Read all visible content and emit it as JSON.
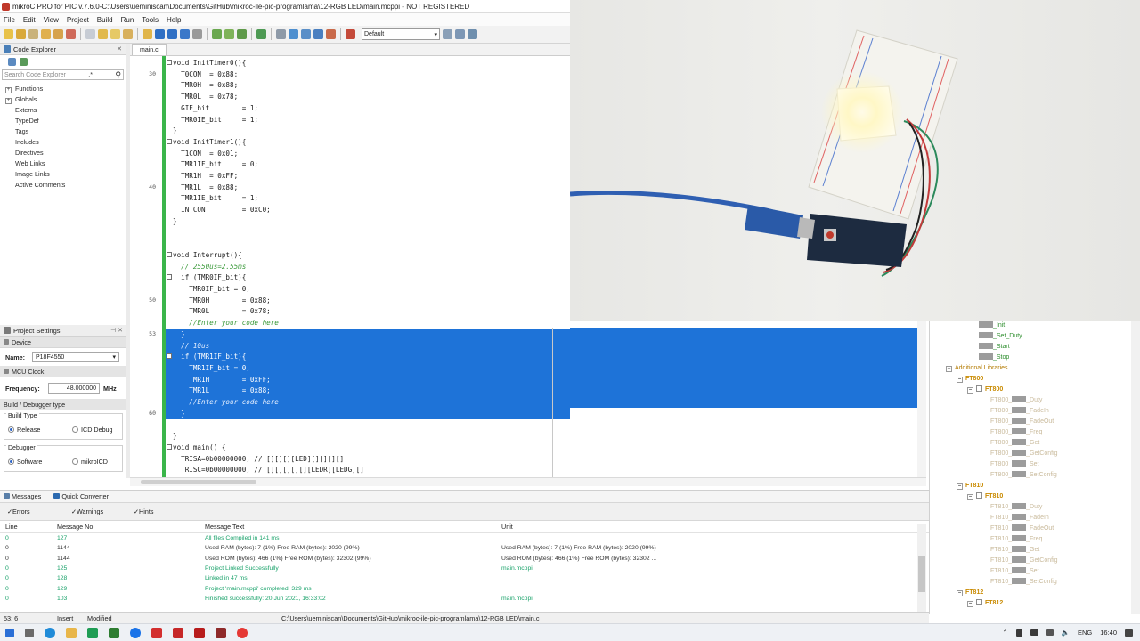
{
  "window": {
    "title": "mikroC PRO for PIC v.7.6.0-C:\\Users\\ueminiscan\\Documents\\GitHub\\mikroc-ile-pic-programlama\\12-RGB LED\\main.mcppi - NOT REGISTERED"
  },
  "menu": [
    "File",
    "Edit",
    "View",
    "Project",
    "Build",
    "Run",
    "Tools",
    "Help"
  ],
  "toolbar": {
    "config_combo": "Default"
  },
  "code_explorer": {
    "title": "Code Explorer",
    "close": "✕",
    "search_placeholder": "Search Code Explorer",
    "search_glyph": ".*",
    "items": [
      {
        "expander": "+",
        "label": "Functions"
      },
      {
        "expander": "+",
        "label": "Globals"
      },
      {
        "expander": "",
        "label": "Externs"
      },
      {
        "expander": "",
        "label": "TypeDef"
      },
      {
        "expander": "",
        "label": "Tags"
      },
      {
        "expander": "",
        "label": "Includes"
      },
      {
        "expander": "",
        "label": "Directives"
      },
      {
        "expander": "",
        "label": "Web Links"
      },
      {
        "expander": "",
        "label": "Image Links"
      },
      {
        "expander": "",
        "label": "Active Comments"
      }
    ]
  },
  "project_settings": {
    "title": "Project Settings",
    "device_group": "Device",
    "name_label": "Name:",
    "name_value": "P18F4550",
    "mcu_clock_group": "MCU Clock",
    "freq_label": "Frequency:",
    "freq_value": "48.000000",
    "freq_unit": "MHz",
    "build_group": "Build / Debugger type",
    "build_type_label": "Build Type",
    "release": "Release",
    "icd_debug": "ICD Debug",
    "debugger_label": "Debugger",
    "software": "Software",
    "mikroicd": "mikroICD"
  },
  "editor": {
    "tab": "main.c",
    "line_numbers": [
      {
        "n": "30",
        "row": 1
      },
      {
        "n": "40",
        "row": 11
      },
      {
        "n": "50",
        "row": 21
      },
      {
        "n": "53",
        "row": 24
      },
      {
        "n": "60",
        "row": 31
      }
    ],
    "lines": [
      {
        "text": "void InitTimer0(){",
        "mark": true
      },
      {
        "text": "  T0CON  = 0x88;"
      },
      {
        "text": "  TMR0H  = 0x88;"
      },
      {
        "text": "  TMR0L  = 0x78;"
      },
      {
        "text": "  GIE_bit        = 1;"
      },
      {
        "text": "  TMR0IE_bit     = 1;"
      },
      {
        "text": "}"
      },
      {
        "text": "void InitTimer1(){",
        "mark": true
      },
      {
        "text": "  T1CON  = 0x01;"
      },
      {
        "text": "  TMR1IF_bit     = 0;"
      },
      {
        "text": "  TMR1H  = 0xFF;"
      },
      {
        "text": "  TMR1L  = 0x88;"
      },
      {
        "text": "  TMR1IE_bit     = 1;"
      },
      {
        "text": "  INTCON         = 0xC0;"
      },
      {
        "text": "}"
      },
      {
        "text": ""
      },
      {
        "text": ""
      },
      {
        "text": "void Interrupt(){",
        "mark": true
      },
      {
        "text": "  // 2550us=2.55ms",
        "cmt": true
      },
      {
        "text": "  if (TMR0IF_bit){",
        "mark": true
      },
      {
        "text": "    TMR0IF_bit = 0;"
      },
      {
        "text": "    TMR0H        = 0x88;"
      },
      {
        "text": "    TMR0L        = 0x78;"
      },
      {
        "text": "    //Enter your code here",
        "cmt": true
      },
      {
        "text": "  }",
        "sel": true
      },
      {
        "text": "  // 10us",
        "sel": true,
        "cmt": true
      },
      {
        "text": "  if (TMR1IF_bit){",
        "sel": true,
        "mark": true
      },
      {
        "text": "    TMR1IF_bit = 0;",
        "sel": true
      },
      {
        "text": "    TMR1H        = 0xFF;",
        "sel": true
      },
      {
        "text": "    TMR1L        = 0x88;",
        "sel": true
      },
      {
        "text": "    //Enter your code here",
        "sel": true,
        "cmt": true
      },
      {
        "text": "  }",
        "sel": true
      },
      {
        "text": ""
      },
      {
        "text": "}"
      },
      {
        "text": "void main() {",
        "mark": true
      },
      {
        "text": "  TRISA=0b00000000; // [][][][LED][][][][]",
        "trail_cmt": true
      },
      {
        "text": "  TRISC=0b00000000; // [][][][][][LEDR][LEDG][]",
        "trail_cmt": true
      }
    ]
  },
  "library_manager": {
    "items": [
      {
        "type": "item-green",
        "label": "_Init",
        "level": 3
      },
      {
        "type": "item-green",
        "label": "_Set_Duty",
        "level": 3
      },
      {
        "type": "item-green",
        "label": "_Start",
        "level": 3
      },
      {
        "type": "item-green",
        "label": "_Stop",
        "level": 3
      },
      {
        "type": "lib",
        "label": "Additional Libraries",
        "level": 0,
        "exp": "–"
      },
      {
        "type": "ft",
        "label": "FT800",
        "level": 1,
        "exp": "–"
      },
      {
        "type": "ftchk",
        "label": "FT800",
        "level": 2,
        "exp": "–"
      },
      {
        "type": "item",
        "label": "FT800_",
        "suffix": "_Duty"
      },
      {
        "type": "item",
        "label": "FT800_",
        "suffix": "_FadeIn"
      },
      {
        "type": "item",
        "label": "FT800_",
        "suffix": "_FadeOut"
      },
      {
        "type": "item",
        "label": "FT800_",
        "suffix": "_Freq"
      },
      {
        "type": "item",
        "label": "FT800_",
        "suffix": "_Get"
      },
      {
        "type": "item",
        "label": "FT800_",
        "suffix": "_GetConfig"
      },
      {
        "type": "item",
        "label": "FT800_",
        "suffix": "_Set"
      },
      {
        "type": "item",
        "label": "FT800_",
        "suffix": "_SetConfig"
      },
      {
        "type": "ft",
        "label": "FT810",
        "level": 1,
        "exp": "–"
      },
      {
        "type": "ftchk",
        "label": "FT810",
        "level": 2,
        "exp": "–"
      },
      {
        "type": "item",
        "label": "FT810_",
        "suffix": "_Duty"
      },
      {
        "type": "item",
        "label": "FT810_",
        "suffix": "_FadeIn"
      },
      {
        "type": "item",
        "label": "FT810_",
        "suffix": "_FadeOut"
      },
      {
        "type": "item",
        "label": "FT810_",
        "suffix": "_Freq"
      },
      {
        "type": "item",
        "label": "FT810_",
        "suffix": "_Get"
      },
      {
        "type": "item",
        "label": "FT810_",
        "suffix": "_GetConfig"
      },
      {
        "type": "item",
        "label": "FT810_",
        "suffix": "_Set"
      },
      {
        "type": "item",
        "label": "FT810_",
        "suffix": "_SetConfig"
      },
      {
        "type": "ft",
        "label": "FT812",
        "level": 1,
        "exp": "–"
      },
      {
        "type": "ftchk",
        "label": "FT812",
        "level": 2,
        "exp": "–"
      }
    ]
  },
  "messages": {
    "tabs": [
      "Messages",
      "Quick Converter"
    ],
    "filters": [
      "Errors",
      "Warnings",
      "Hints"
    ],
    "columns": [
      "Line",
      "Message No.",
      "Message Text",
      "Unit"
    ],
    "rows": [
      {
        "line": "0",
        "no": "127",
        "text": "All files Compiled in 141 ms",
        "unit": ""
      },
      {
        "line": "0",
        "no": "1144",
        "text": "Used RAM (bytes): 7 (1%)  Free RAM (bytes): 2020 (99%)",
        "unit": "Used RAM (bytes): 7 (1%)  Free RAM (bytes): 2020 (99%)",
        "dark": true
      },
      {
        "line": "0",
        "no": "1144",
        "text": "Used ROM (bytes): 466 (1%)  Free ROM (bytes): 32302 (99%)",
        "unit": "Used ROM (bytes): 466 (1%)  Free ROM (bytes): 32302 ...",
        "dark": true
      },
      {
        "line": "0",
        "no": "125",
        "text": "Project Linked Successfully",
        "unit": "main.mcppi"
      },
      {
        "line": "0",
        "no": "128",
        "text": "Linked in 47 ms",
        "unit": ""
      },
      {
        "line": "0",
        "no": "129",
        "text": "Project 'main.mcppi' completed: 329 ms",
        "unit": ""
      },
      {
        "line": "0",
        "no": "103",
        "text": "Finished successfully: 20 Jun 2021, 16:33:02",
        "unit": "main.mcppi"
      }
    ]
  },
  "status": {
    "pos": "53: 6",
    "mode": "Insert",
    "state": "Modified",
    "path": "C:\\Users\\ueminiscan\\Documents\\GitHub\\mikroc-ile-pic-programlama\\12-RGB LED\\main.c"
  },
  "taskbar": {
    "lang": "ENG",
    "time": "16:40"
  },
  "colors": {
    "selection": "#1e73d8",
    "green_bar": "#3ab54a",
    "msg_green": "#19a26a",
    "lib_orange": "#c98a00"
  }
}
